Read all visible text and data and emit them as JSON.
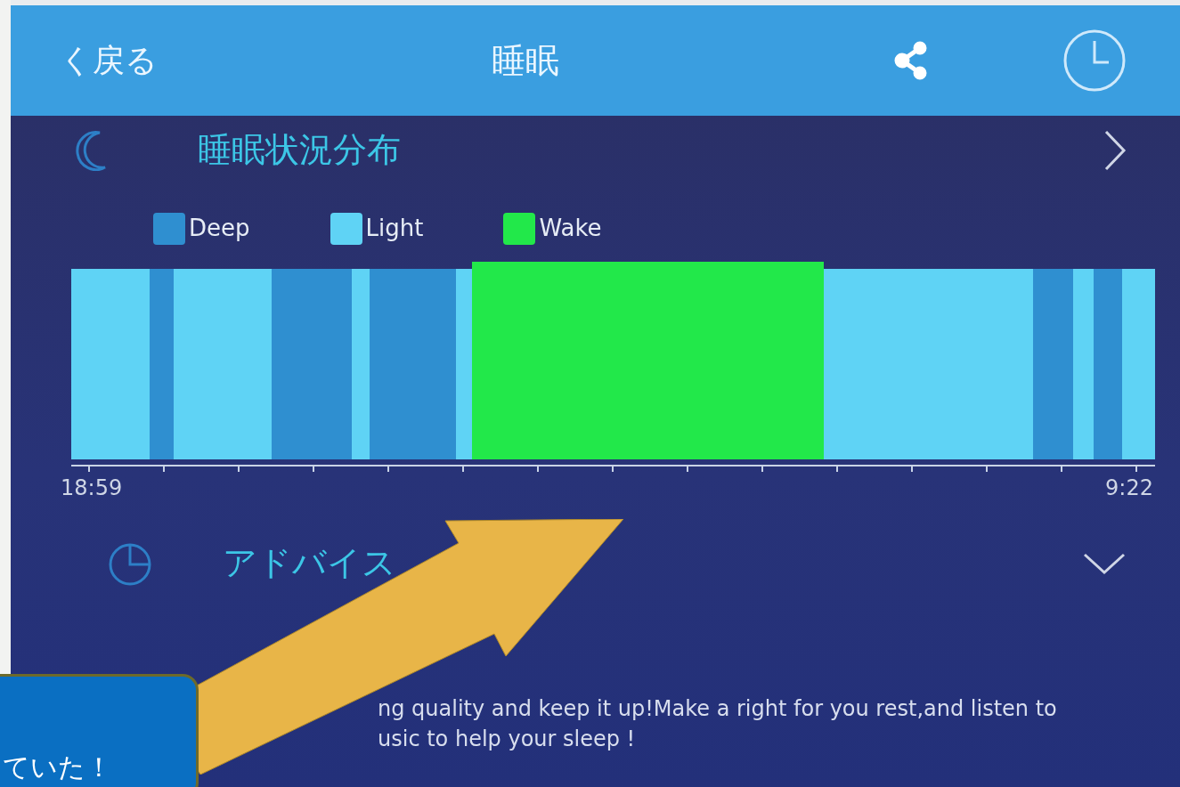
{
  "header": {
    "back": "く戻る",
    "title": "睡眠"
  },
  "distribution": {
    "title": "睡眠状況分布"
  },
  "legend": [
    {
      "label": "Deep",
      "color": "#2f8fd0"
    },
    {
      "label": "Light",
      "color": "#5fd3f5"
    },
    {
      "label": "Wake",
      "color": "#22e84a"
    }
  ],
  "timeline": {
    "start": "18:59",
    "end": "9:22"
  },
  "advice": {
    "title": "アドバイス",
    "lines": [
      "ng quality and keep it up!Make a right for you rest,and listen to",
      "usic to help your sleep !"
    ]
  },
  "callout": {
    "text": "ていた！"
  }
}
